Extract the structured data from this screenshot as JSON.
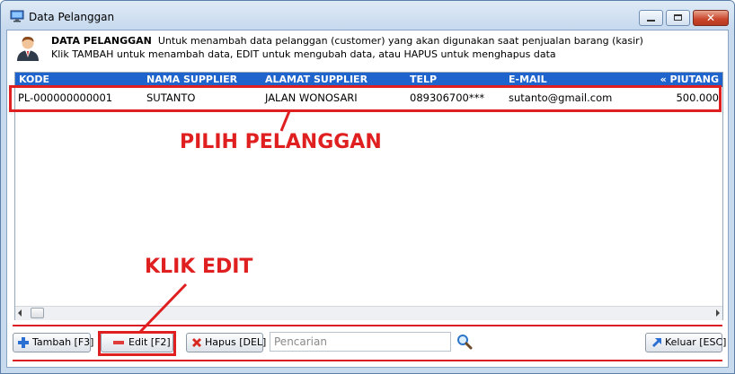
{
  "window": {
    "title": "Data Pelanggan"
  },
  "header": {
    "title": "DATA PELANGGAN",
    "description": "Untuk menambah data pelanggan (customer) yang akan digunakan saat penjualan barang (kasir)",
    "instructions": "Klik TAMBAH untuk menambah data, EDIT untuk mengubah data, atau HAPUS untuk menghapus data"
  },
  "grid": {
    "columns": [
      "KODE",
      "NAMA SUPPLIER",
      "ALAMAT SUPPLIER",
      "TELP",
      "E-MAIL",
      "« PIUTANG"
    ],
    "rows": [
      [
        "PL-000000000001",
        "SUTANTO",
        "JALAN WONOSARI",
        "089306700***",
        "sutanto@gmail.com",
        "500.000"
      ]
    ]
  },
  "annotations": {
    "select_customer": "PILIH PELANGGAN",
    "click_edit": "KLIK EDIT"
  },
  "toolbar": {
    "add_label": "Tambah [F3]",
    "edit_label": "Edit [F2]",
    "delete_label": "Hapus [DEL]",
    "search_placeholder": "Pencarian",
    "exit_label": "Keluar [ESC]"
  },
  "colors": {
    "header_bg": "#1f64cc",
    "annotation_red": "#e02020"
  },
  "icons": {
    "app": "monitor-icon",
    "header": "person-icon",
    "add": "plus-icon",
    "edit": "minus-icon",
    "delete": "x-icon",
    "search": "magnifier-icon",
    "exit": "arrow-icon"
  }
}
